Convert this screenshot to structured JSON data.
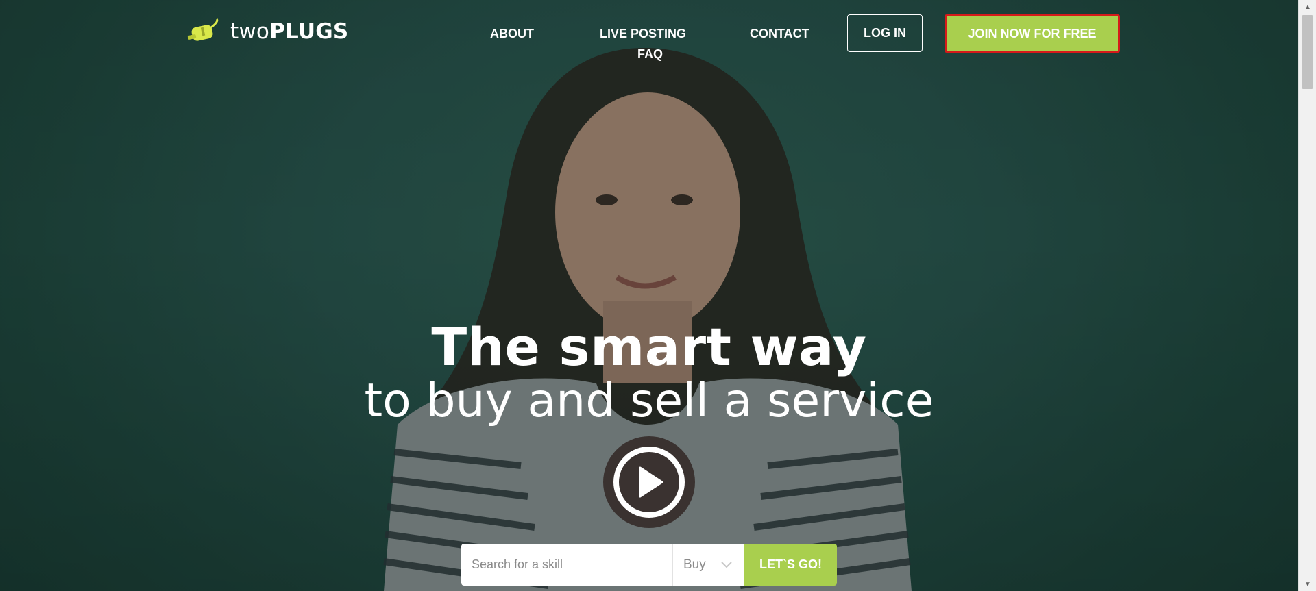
{
  "header": {
    "logo_text_light": "two",
    "logo_text_bold": "PLUGS",
    "nav": {
      "about": "ABOUT",
      "live_posting": "LIVE POSTING",
      "faq": "FAQ",
      "contact": "CONTACT"
    },
    "login_label": "LOG IN",
    "join_label": "JOIN NOW FOR FREE"
  },
  "hero": {
    "headline_line1": "The smart way",
    "headline_line2": "to buy and sell a service"
  },
  "search": {
    "placeholder": "Search for a skill",
    "type_selected": "Buy",
    "submit_label": "LET`S GO!"
  },
  "colors": {
    "accent": "#a9cf4e",
    "highlight_border": "#d61a1a",
    "background": "#234a40"
  },
  "icons": {
    "logo": "plug-logo-icon",
    "play": "play-icon",
    "dropdown": "chevron-down-icon"
  }
}
